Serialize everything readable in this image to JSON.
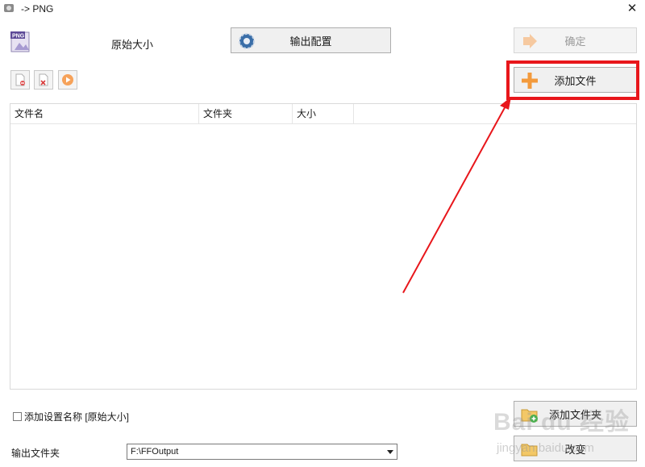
{
  "window": {
    "title": "-> PNG",
    "close_glyph": "✕"
  },
  "preset": {
    "icon_text": "PNG",
    "label": "原始大小"
  },
  "buttons": {
    "output_config": "输出配置",
    "ok": "确定",
    "add_file": "添加文件",
    "add_folder": "添加文件夹",
    "change": "改变"
  },
  "file_list": {
    "columns": [
      "文件名",
      "文件夹",
      "大小",
      ""
    ],
    "rows": []
  },
  "options": {
    "add_setting_name": "添加设置名称 [原始大小]",
    "add_setting_name_checked": false
  },
  "output": {
    "label": "输出文件夹",
    "value": "F:\\FFOutput"
  },
  "watermark": {
    "logo": "Bai du 经验",
    "url": "jingyan.baidu.com"
  },
  "colors": {
    "highlight": "#e8161b",
    "accent_orange": "#f39a3c",
    "button_bg": "#f0f0f0"
  },
  "icons": {
    "app": "app-icon",
    "png": "png-file-icon",
    "output_config": "gear-icon",
    "ok": "arrow-right-icon",
    "add_file": "plus-icon",
    "add_folder": "folder-add-icon",
    "change": "folder-icon",
    "tools": [
      "remove-file-icon",
      "clear-list-icon",
      "play-icon"
    ]
  }
}
